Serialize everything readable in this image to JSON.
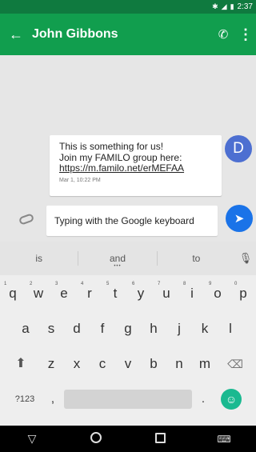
{
  "status_bar": {
    "time": "2:37",
    "bluetooth_icon": "bluetooth-icon",
    "signal_icon": "signal-icon",
    "battery_icon": "battery-icon"
  },
  "app_bar": {
    "title": "John Gibbons",
    "back_icon": "arrow-left-icon",
    "call_icon": "phone-icon",
    "more_icon": "more-vert-icon",
    "color": "#119e4e"
  },
  "message": {
    "text": "This is something for us!\nJoin my FAMILO group here:",
    "link": "https://m.familo.net/erMEFAA",
    "timestamp": "Mar 1, 10:22 PM",
    "avatar_letter": "D",
    "avatar_color": "#4d6fd1"
  },
  "compose": {
    "value": "Typing with the Google keyboard",
    "attach_icon": "attach-icon",
    "send_icon": "send-icon",
    "send_color": "#1a73e8"
  },
  "keyboard": {
    "suggestions": [
      "is",
      "and",
      "to"
    ],
    "mic_icon": "mic-icon",
    "row1": [
      {
        "key": "q",
        "hint": "1"
      },
      {
        "key": "w",
        "hint": "2"
      },
      {
        "key": "e",
        "hint": "3"
      },
      {
        "key": "r",
        "hint": "4"
      },
      {
        "key": "t",
        "hint": "5"
      },
      {
        "key": "y",
        "hint": "6"
      },
      {
        "key": "u",
        "hint": "7"
      },
      {
        "key": "i",
        "hint": "8"
      },
      {
        "key": "o",
        "hint": "9"
      },
      {
        "key": "p",
        "hint": "0"
      }
    ],
    "row2": [
      "a",
      "s",
      "d",
      "f",
      "g",
      "h",
      "j",
      "k",
      "l"
    ],
    "row3": [
      "z",
      "x",
      "c",
      "v",
      "b",
      "n",
      "m"
    ],
    "symbols_label": "?123",
    "comma": ",",
    "period": ".",
    "emoji_icon": "emoji-icon",
    "emoji_color": "#1ab990"
  },
  "nav_bar": {
    "back_icon": "triangle-back-icon",
    "home_icon": "circle-home-icon",
    "recents_icon": "square-recents-icon",
    "keyboard_icon": "keyboard-icon"
  }
}
